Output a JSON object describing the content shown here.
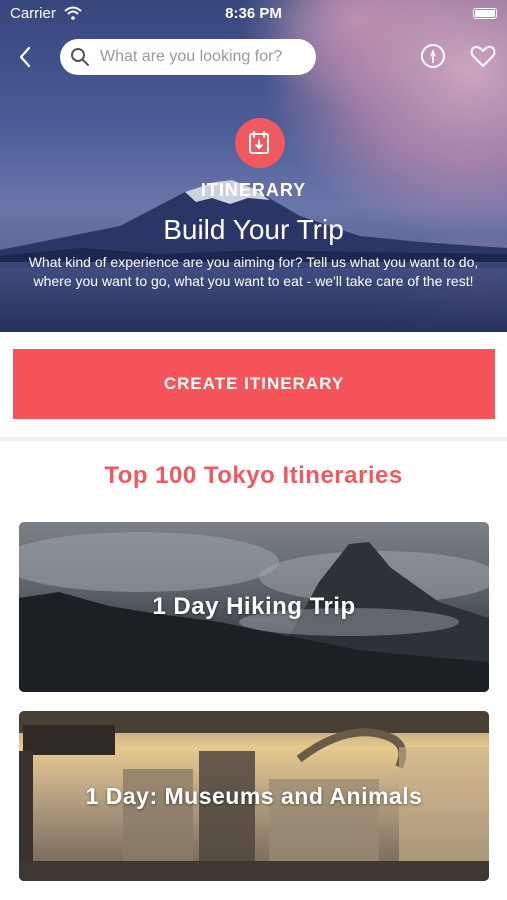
{
  "status_bar": {
    "carrier": "Carrier",
    "time": "8:36 PM"
  },
  "search": {
    "placeholder": "What are you looking for?"
  },
  "hero": {
    "kicker": "ITINERARY",
    "title": "Build Your Trip",
    "description": "What kind of experience are you aiming for? Tell us what you want to do, where you want to go, what you want to eat - we'll take care of the rest!"
  },
  "cta": {
    "label": "CREATE ITINERARY"
  },
  "section": {
    "title": "Top 100 Tokyo Itineraries"
  },
  "itineraries": [
    {
      "title": "1 Day Hiking Trip"
    },
    {
      "title": "1 Day: Museums and Animals"
    }
  ],
  "colors": {
    "accent": "#f5545a",
    "section_title": "#ef5a60",
    "badge": "#f05a5e"
  },
  "icons": [
    "back-icon",
    "search-icon",
    "compass-icon",
    "heart-icon",
    "itinerary-icon",
    "wifi-icon",
    "battery-icon"
  ]
}
